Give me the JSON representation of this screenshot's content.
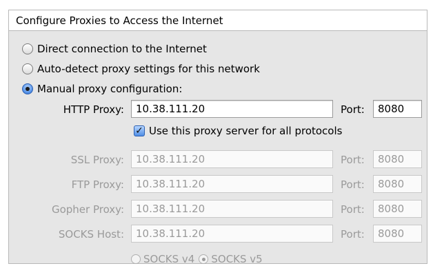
{
  "group_title": "Configure Proxies to Access the Internet",
  "options": [
    {
      "label": "Direct connection to the Internet",
      "selected": false
    },
    {
      "label": "Auto-detect proxy settings for this network",
      "selected": false
    },
    {
      "label": "Manual proxy configuration:",
      "selected": true
    }
  ],
  "http": {
    "label": "HTTP Proxy:",
    "value": "10.38.111.20",
    "port_label": "Port:",
    "port": "8080"
  },
  "use_for_all": {
    "label": "Use this proxy server for all protocols",
    "checked": true
  },
  "ssl": {
    "label": "SSL Proxy:",
    "value": "10.38.111.20",
    "port_label": "Port:",
    "port": "8080"
  },
  "ftp": {
    "label": "FTP Proxy:",
    "value": "10.38.111.20",
    "port_label": "Port:",
    "port": "8080"
  },
  "gopher": {
    "label": "Gopher Proxy:",
    "value": "10.38.111.20",
    "port_label": "Port:",
    "port": "8080"
  },
  "socks": {
    "label": "SOCKS Host:",
    "value": "10.38.111.20",
    "port_label": "Port:",
    "port": "8080"
  },
  "socks_versions": [
    {
      "label": "SOCKS v4",
      "selected": false
    },
    {
      "label": "SOCKS v5",
      "selected": true
    }
  ]
}
